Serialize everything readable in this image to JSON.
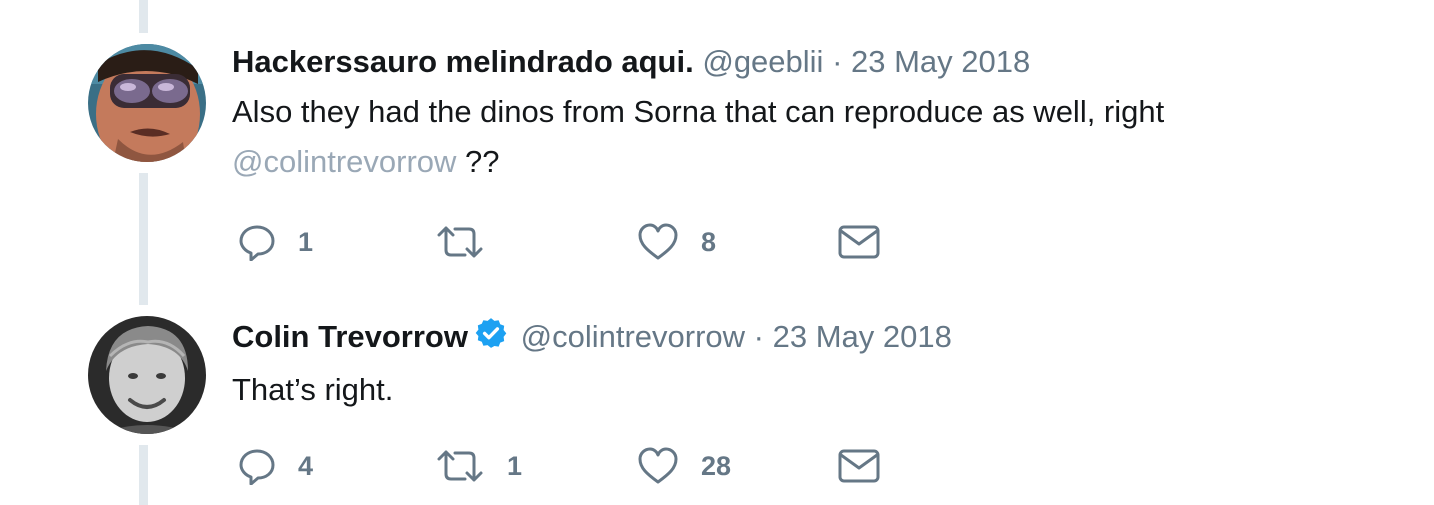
{
  "tweets": [
    {
      "author_name": "Hackerssauro melindrado aqui.",
      "handle": "@geeblii",
      "separator": "·",
      "date": "23 May 2018",
      "verified": false,
      "text_line1": "Also they had the dinos from Sorna that can reproduce as well, right",
      "mention": "@colintrevorrow",
      "text_after_mention": "??",
      "replies": "1",
      "retweets": "",
      "likes": "8",
      "avatar_icon": "avatar-sunglasses-man"
    },
    {
      "author_name": "Colin Trevorrow",
      "handle": "@colintrevorrow",
      "separator": "·",
      "date": "23 May 2018",
      "verified": true,
      "text_line1": "That’s right.",
      "replies": "4",
      "retweets": "1",
      "likes": "28",
      "avatar_icon": "avatar-child-bw-photo"
    }
  ],
  "icons": {
    "reply": "reply-icon",
    "retweet": "retweet-icon",
    "like": "heart-icon",
    "dm": "envelope-icon",
    "verified": "verified-badge-icon"
  },
  "colors": {
    "text": "#14171a",
    "secondary": "#657786",
    "mention": "#9aa8b6",
    "verified": "#1da1f2",
    "thread_line": "#e1e8ed"
  }
}
